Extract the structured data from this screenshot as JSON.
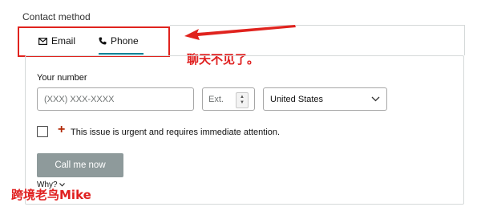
{
  "section_title": "Contact method",
  "tabs": [
    {
      "label": "Email",
      "icon": "envelope-icon"
    },
    {
      "label": "Phone",
      "icon": "phone-icon",
      "active": true
    }
  ],
  "annotation": {
    "text": "聊天不见了。",
    "color": "#e0231e"
  },
  "form": {
    "number_label": "Your number",
    "number_placeholder": "(XXX) XXX-XXXX",
    "ext_placeholder": "Ext.",
    "country_value": "United States",
    "urgent_text": "This issue is urgent and requires immediate attention.",
    "urgent_marker": "+",
    "call_button": "Call me now",
    "why_link": "Why?"
  },
  "watermark": "跨境老鸟Mike",
  "colors": {
    "accent_underline": "#008296",
    "button_disabled": "#8e9a9b",
    "highlight_red": "#e0231e"
  }
}
